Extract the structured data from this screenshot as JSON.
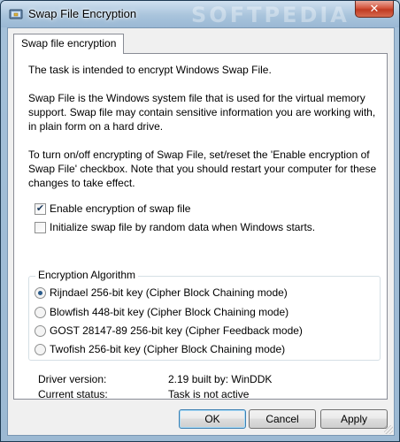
{
  "window": {
    "title": "Swap File Encryption",
    "watermark": "SOFTPEDIA",
    "close_label": "✕"
  },
  "tab": {
    "label": "Swap file encryption"
  },
  "content": {
    "para1": "The task is intended to encrypt Windows Swap File.",
    "para2": "Swap File is the Windows system file that is used for the virtual memory support. Swap file may contain sensitive information you are working with, in plain form on a hard drive.",
    "para3": "To turn on/off encrypting of Swap File, set/reset the 'Enable encryption of Swap File' checkbox. Note that you should restart your computer for these changes to take effect."
  },
  "checkboxes": [
    {
      "label": "Enable encryption of swap file",
      "checked": true
    },
    {
      "label": "Initialize swap file by random data when Windows starts.",
      "checked": false
    }
  ],
  "algorithm": {
    "group_label": "Encryption Algorithm",
    "options": [
      {
        "label": "Rijndael 256-bit key (Cipher Block Chaining mode)",
        "selected": true
      },
      {
        "label": "Blowfish 448-bit key (Cipher Block Chaining mode)",
        "selected": false
      },
      {
        "label": "GOST 28147-89 256-bit key (Cipher Feedback mode)",
        "selected": false
      },
      {
        "label": "Twofish 256-bit key (Cipher Block Chaining mode)",
        "selected": false
      }
    ]
  },
  "info": {
    "driver_label": "Driver version:",
    "driver_value": "2.19 built by: WinDDK",
    "status_label": "Current status:",
    "status_value": "Task is not active"
  },
  "buttons": {
    "ok": "OK",
    "cancel": "Cancel",
    "apply": "Apply"
  },
  "colors": {
    "selection": "#2a5a8a",
    "check": "#1c3a5c"
  }
}
